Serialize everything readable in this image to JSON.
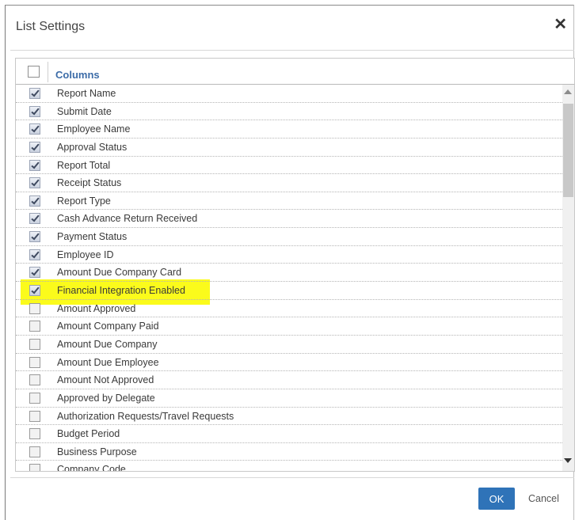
{
  "dialog": {
    "title": "List Settings",
    "close_icon": "close-icon",
    "header": {
      "column_label": "Columns",
      "select_all_checked": false
    },
    "highlight_color": "#fbfb1b",
    "accent_color": "#2f73b8",
    "items": [
      {
        "label": "Report Name",
        "checked": true
      },
      {
        "label": "Submit Date",
        "checked": true
      },
      {
        "label": "Employee Name",
        "checked": true
      },
      {
        "label": "Approval Status",
        "checked": true
      },
      {
        "label": "Report Total",
        "checked": true
      },
      {
        "label": "Receipt Status",
        "checked": true
      },
      {
        "label": "Report Type",
        "checked": true
      },
      {
        "label": "Cash Advance Return Received",
        "checked": true
      },
      {
        "label": "Payment Status",
        "checked": true
      },
      {
        "label": "Employee ID",
        "checked": true
      },
      {
        "label": "Amount Due Company Card",
        "checked": true
      },
      {
        "label": "Financial Integration Enabled",
        "checked": true,
        "highlighted": true
      },
      {
        "label": "Amount Approved",
        "checked": false
      },
      {
        "label": "Amount Company Paid",
        "checked": false
      },
      {
        "label": "Amount Due Company",
        "checked": false
      },
      {
        "label": "Amount Due Employee",
        "checked": false
      },
      {
        "label": "Amount Not Approved",
        "checked": false
      },
      {
        "label": "Approved by Delegate",
        "checked": false
      },
      {
        "label": "Authorization Requests/Travel Requests",
        "checked": false
      },
      {
        "label": "Budget Period",
        "checked": false
      },
      {
        "label": "Business Purpose",
        "checked": false
      },
      {
        "label": "Company Code",
        "checked": false
      }
    ],
    "footer": {
      "ok_label": "OK",
      "cancel_label": "Cancel"
    }
  }
}
